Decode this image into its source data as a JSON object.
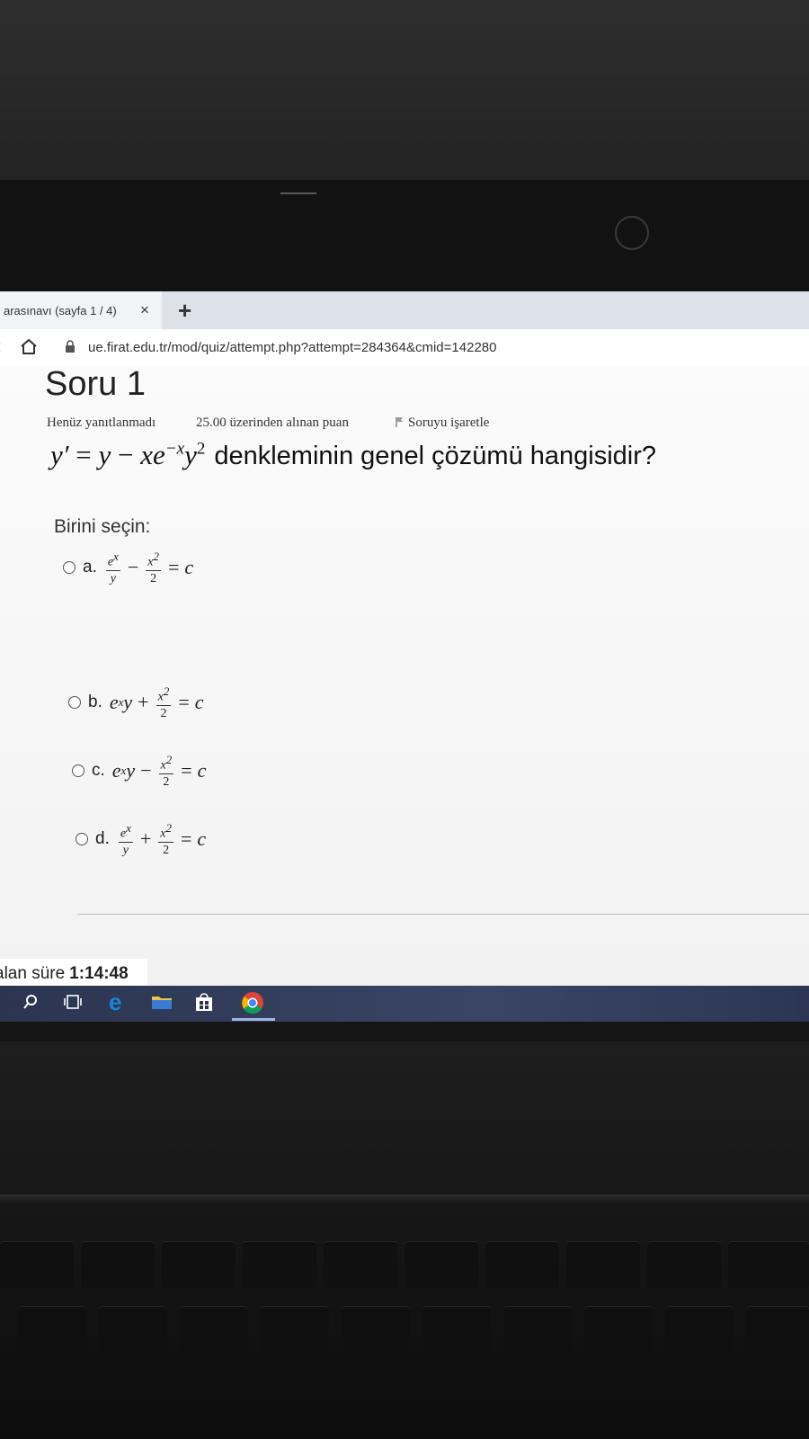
{
  "browser": {
    "tab_title": "arasınavı (sayfa 1 / 4)",
    "tab_close": "×",
    "new_tab": "+",
    "url": "ue.firat.edu.tr/mod/quiz/attempt.php?attempt=284364&cmid=142280"
  },
  "question": {
    "heading": "Soru 1",
    "status": "Henüz yanıtlanmadı",
    "points": "25.00 üzerinden alınan puan",
    "flag_label": "Soruyu işaretle",
    "text_suffix": "denkleminin genel çözümü hangisidir?",
    "prompt": "Birini seçin:",
    "options": [
      {
        "letter": "a."
      },
      {
        "letter": "b."
      },
      {
        "letter": "c."
      },
      {
        "letter": "d."
      }
    ]
  },
  "timer": {
    "label": "alan süre",
    "value": "1:14:48"
  },
  "icons": {
    "home": "home-icon",
    "lock": "lock-icon",
    "flag": "flag-icon",
    "search": "search-icon",
    "task_view": "task-view-icon",
    "edge": "edge-icon",
    "files": "file-explorer-icon",
    "store": "store-icon",
    "chrome": "chrome-icon"
  },
  "colors": {
    "tab_bar": "#dde1e8",
    "taskbar": "#2b3550",
    "edge_blue": "#1b84d6"
  }
}
